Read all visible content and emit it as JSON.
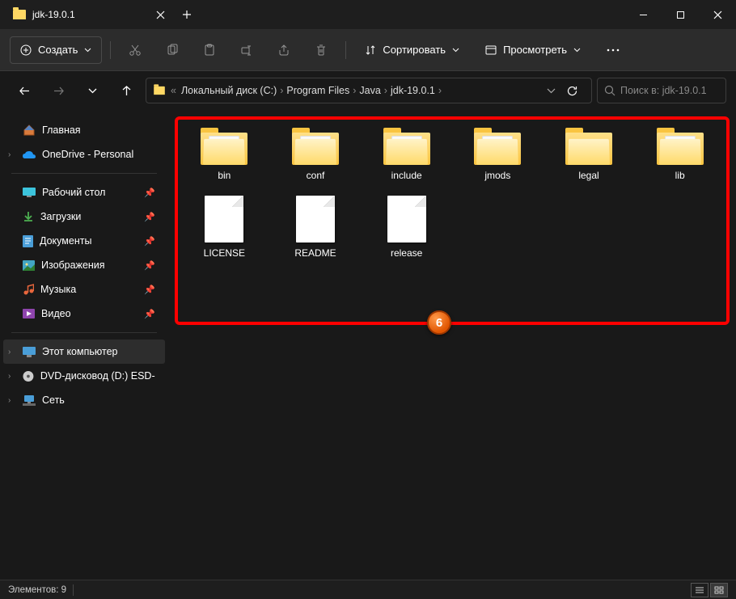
{
  "window": {
    "title": "jdk-19.0.1"
  },
  "toolbar": {
    "create_label": "Создать",
    "sort_label": "Сортировать",
    "view_label": "Просмотреть"
  },
  "breadcrumbs": [
    "Локальный диск (C:)",
    "Program Files",
    "Java",
    "jdk-19.0.1"
  ],
  "search": {
    "placeholder": "Поиск в: jdk-19.0.1"
  },
  "sidebar": {
    "home": "Главная",
    "onedrive": "OneDrive - Personal",
    "desktop": "Рабочий стол",
    "downloads": "Загрузки",
    "documents": "Документы",
    "pictures": "Изображения",
    "music": "Музыка",
    "videos": "Видео",
    "thispc": "Этот компьютер",
    "dvd": "DVD-дисковод (D:) ESD-IS",
    "network": "Сеть"
  },
  "items": [
    {
      "name": "bin",
      "type": "folder-gear"
    },
    {
      "name": "conf",
      "type": "folder-doc"
    },
    {
      "name": "include",
      "type": "folder-doc"
    },
    {
      "name": "jmods",
      "type": "folder-doc"
    },
    {
      "name": "legal",
      "type": "folder"
    },
    {
      "name": "lib",
      "type": "folder-doc"
    },
    {
      "name": "LICENSE",
      "type": "file"
    },
    {
      "name": "README",
      "type": "file"
    },
    {
      "name": "release",
      "type": "file"
    }
  ],
  "status": {
    "count_label": "Элементов: 9"
  },
  "annotation": {
    "number": "6"
  }
}
